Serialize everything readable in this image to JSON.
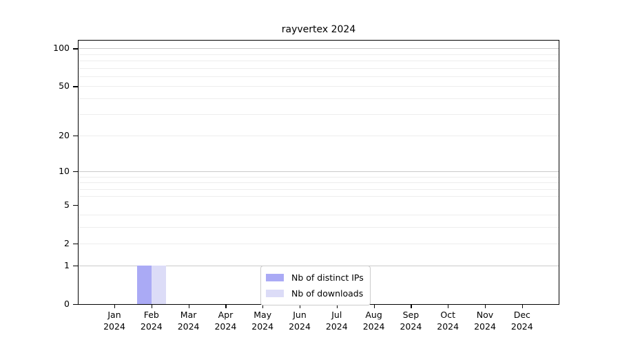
{
  "chart_data": {
    "type": "bar",
    "title": "rayvertex 2024",
    "year_label": "2024",
    "categories": [
      "Jan",
      "Feb",
      "Mar",
      "Apr",
      "May",
      "Jun",
      "Jul",
      "Aug",
      "Sep",
      "Oct",
      "Nov",
      "Dec"
    ],
    "series": [
      {
        "key": "distinct-ips",
        "name": "Nb of distinct IPs",
        "color": "#aaaaf5",
        "values": [
          0,
          1,
          0,
          0,
          0,
          0,
          0,
          0,
          0,
          0,
          0,
          0
        ]
      },
      {
        "key": "downloads",
        "name": "Nb of downloads",
        "color": "#dcdcf7",
        "values": [
          0,
          1,
          0,
          0,
          0,
          0,
          0,
          0,
          0,
          0,
          0,
          0
        ]
      }
    ],
    "y_axis": {
      "scale": "log1p",
      "ticks": [
        0,
        1,
        2,
        5,
        10,
        20,
        50,
        100
      ],
      "major_grid_values": [
        1,
        10,
        100
      ],
      "minor_grid_values": [
        2,
        3,
        4,
        6,
        7,
        8,
        9,
        20,
        30,
        40,
        50,
        60,
        70,
        80,
        90
      ],
      "range_max": 115
    },
    "legend": {
      "position": "lower-center-inside"
    },
    "colors": {
      "background": "#ffffff",
      "axis": "#000000",
      "major_grid": "#c9c9c9",
      "minor_grid": "#ededed",
      "legend_border": "#cbcbcb"
    },
    "grid": "horizontal"
  }
}
